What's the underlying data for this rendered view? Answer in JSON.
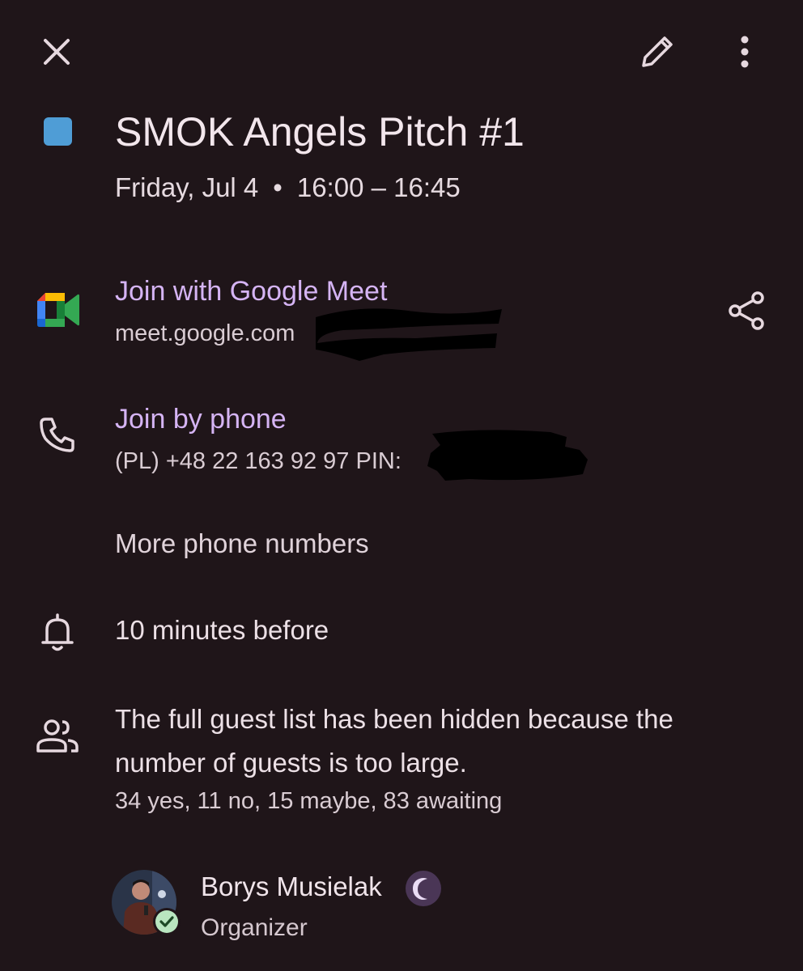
{
  "toolbar": {
    "close_icon": "close-icon",
    "edit_icon": "pencil-icon",
    "more_icon": "more-vert-icon"
  },
  "event": {
    "color": "#4f9dd6",
    "title": "SMOK Angels Pitch #1",
    "day": "Friday, Jul 4",
    "separator": "•",
    "time": "16:00 – 16:45"
  },
  "conference": {
    "icon": "google-meet-icon",
    "join_label": "Join with Google Meet",
    "url": "meet.google.com",
    "share_icon": "share-icon"
  },
  "phone": {
    "icon": "phone-icon",
    "join_label": "Join by phone",
    "detail": "(PL) +48 22 163 92 97 PIN:",
    "more_label": "More phone numbers"
  },
  "reminder": {
    "icon": "bell-icon",
    "text": "10 minutes before"
  },
  "guests": {
    "icon": "people-icon",
    "note": "The full guest list has been hidden because the number of guests is too large.",
    "counts": "34 yes, 11 no, 15 maybe, 83 awaiting"
  },
  "organizer": {
    "name": "Borys Musielak",
    "role": "Organizer",
    "status_icon": "moon-icon",
    "rsvp_icon": "check-circle-icon"
  },
  "colors": {
    "background": "#1f1519",
    "link": "#d5b4f4",
    "accent_badge": "#4a3656",
    "check_badge": "#b9e6c0"
  }
}
